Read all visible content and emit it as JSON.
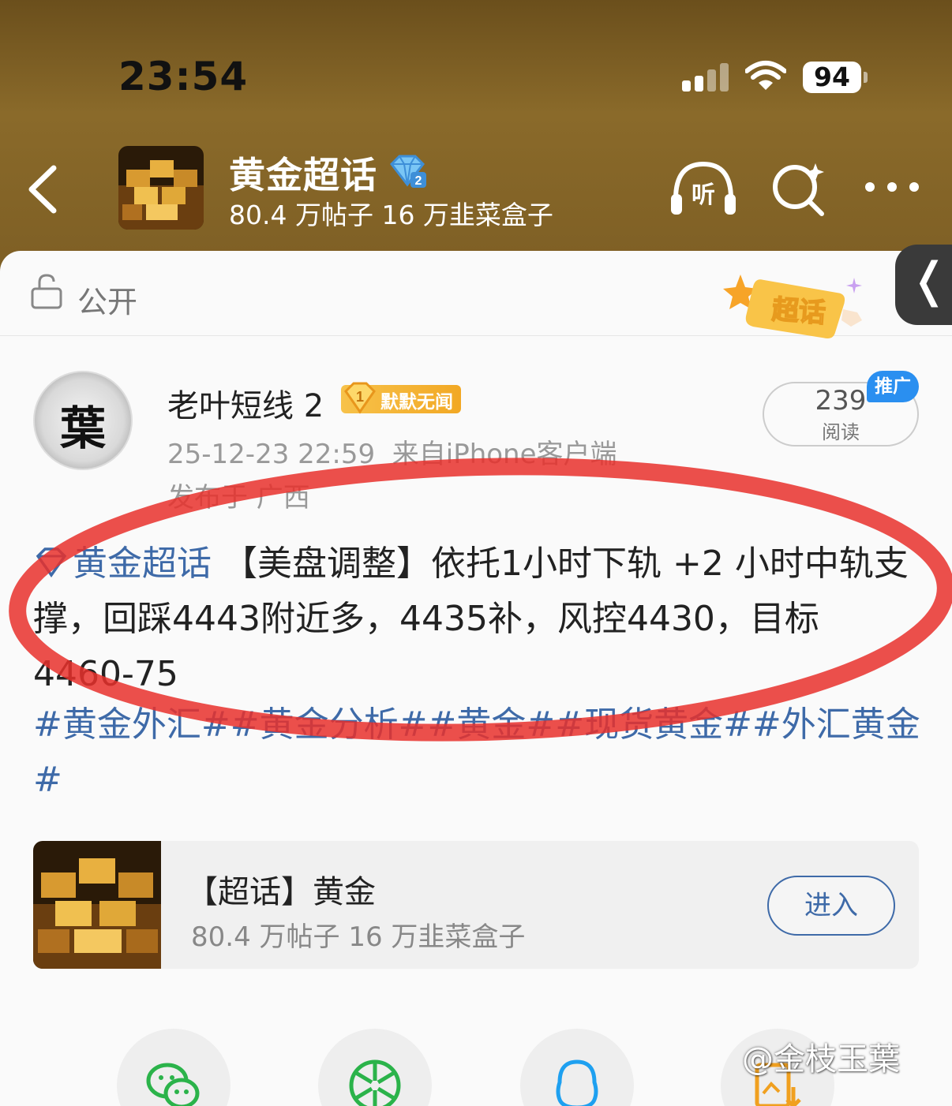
{
  "status_bar": {
    "time": "23:54",
    "battery": "94"
  },
  "header": {
    "topic_title": "黄金超话",
    "topic_stats": "80.4 万帖子 16 万韭菜盒子",
    "listen_label": "听"
  },
  "visibility": {
    "label": "公开",
    "sticker_text": "超话"
  },
  "side_tab": {
    "glyph": "❬"
  },
  "post": {
    "avatar_char": "葉",
    "username": "老叶短线 2",
    "badge_level": "1",
    "badge_text": "默默无闻",
    "timestamp": "25-12-23 22:59",
    "source": "来自iPhone客户端",
    "location": "发布于 广西",
    "read_count": "239",
    "read_label": "阅读",
    "promo_tag": "推广",
    "topic_link": "黄金超话",
    "body": "【美盘调整】依托1小时下轨 +2 小时中轨支撑，回踩4443附近多，4435补，风控4430，目标4460-75",
    "hashtags": "#黄金外汇##黄金分析##黄金##现货黄金##外汇黄金#"
  },
  "topic_card": {
    "title": "【超话】黄金",
    "stats": "80.4 万帖子 16 万韭菜盒子",
    "enter_label": "进入"
  },
  "share": {
    "items": [
      "wechat-icon",
      "moments-icon",
      "qq-icon",
      "save-image-icon"
    ]
  },
  "watermark": "@金枝玉葉",
  "colors": {
    "link": "#3e6aa8",
    "header": "#7d5e24",
    "annotation": "#e8302c"
  }
}
